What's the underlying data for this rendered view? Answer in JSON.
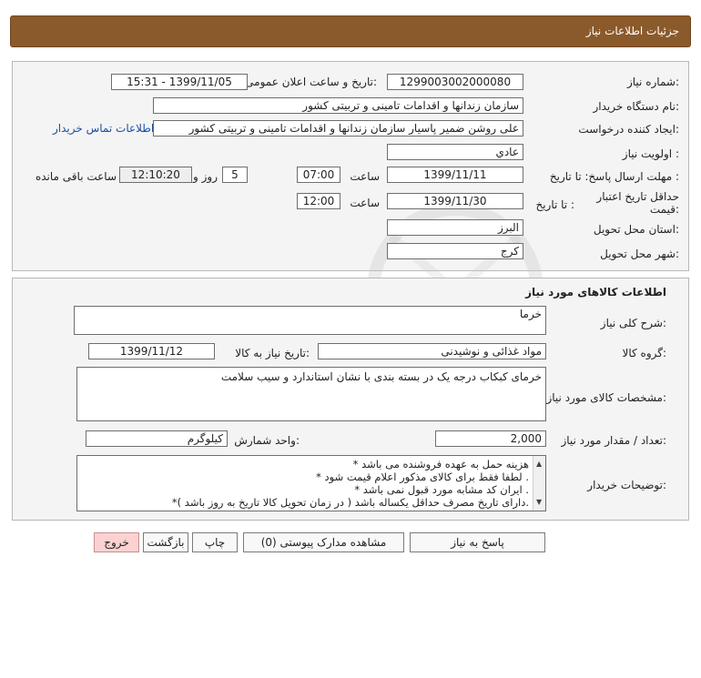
{
  "header": {
    "title": "جزئیات اطلاعات نیاز"
  },
  "request": {
    "need_number_label": "شماره نیاز:",
    "need_number": "1299003002000080",
    "announce_label": "تاریخ و ساعت اعلان عمومی:",
    "announce_value": "1399/11/05 - 15:31",
    "buyer_org_label": "نام دستگاه خریدار:",
    "buyer_org": "سازمان زندانها و اقدامات تامینی و تربیتی کشور",
    "requester_label": "ایجاد کننده درخواست:",
    "requester": "علی روشن ضمیر پاسیار سازمان زندانها و اقدامات تامینی و تربیتی کشور",
    "contact_link": "اطلاعات تماس خریدار",
    "priority_label": "اولویت نیاز :",
    "priority": "عادي",
    "deadline_label": "مهلت ارسال پاسخ: تا تاریخ :",
    "deadline_date": "1399/11/11",
    "time_label": "ساعت",
    "deadline_time": "07:00",
    "days_value": "5",
    "days_label": "روز و",
    "remaining_time": "12:10:20",
    "remaining_label": "ساعت باقی مانده",
    "validity_label": "حداقل تاریخ اعتبار قیمت:",
    "validity_until_label": "تا تاریخ :",
    "validity_date": "1399/11/30",
    "validity_time": "12:00",
    "province_label": "استان محل تحویل:",
    "province": "البرز",
    "city_label": "شهر محل تحویل:",
    "city": "کرج"
  },
  "goods": {
    "section_title": "اطلاعات کالاهای مورد نیاز",
    "summary_label": "شرح کلی نیاز:",
    "summary": "خرما",
    "group_label": "گروه کالا:",
    "group": "مواد غذائی و نوشیدنی",
    "need_date_label": "تاریخ نیاز به کالا:",
    "need_date": "1399/11/12",
    "specs_label": "مشخصات کالای مورد نیاز:",
    "specs": "خرمای کبکاب درجه یک در بسته بندی با نشان استاندارد و سیب سلامت",
    "qty_label": "تعداد / مقدار مورد نیاز:",
    "qty": "2,000",
    "unit_label": "واحد شمارش:",
    "unit": "کیلوگرم",
    "notes_label": "توضیحات خریدار:",
    "notes": [
      "هزینه حمل به عهده فروشنده می باشد *",
      ". لطفا فقط برای کالای مذکور اعلام قیمت شود *",
      ". ایران کد مشابه مورد قبول نمی باشد *",
      ".دارای تاریخ مصرف حداقل یکساله باشد ( در زمان تحویل کالا تاریخ به روز باشد )*"
    ]
  },
  "actions": {
    "respond": "پاسخ به نیاز",
    "attachments": "مشاهده مدارک پیوستی (0)",
    "print": "چاپ",
    "back": "بازگشت",
    "exit": "خروج"
  },
  "colors": {
    "header_bg": "#8b5a2b",
    "link": "#1a4fa0",
    "exit_bg": "#fbd1d1"
  }
}
